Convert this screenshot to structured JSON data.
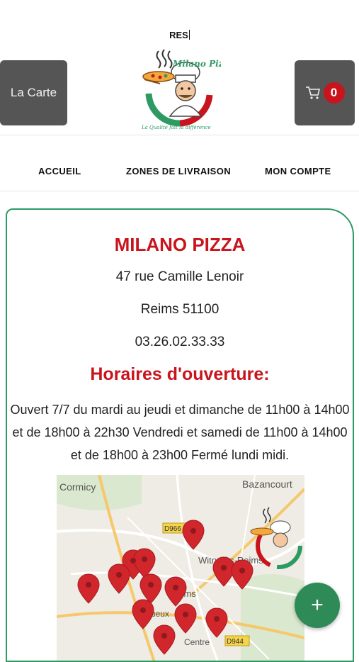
{
  "header": {
    "search_text": "RES",
    "menu_button_label": "La Carte",
    "cart_count": "0",
    "logo_title": "Milano Pizza",
    "logo_slogan": "La Qualité fait la différence"
  },
  "nav": {
    "items": [
      {
        "label": "ACCUEIL"
      },
      {
        "label": "ZONES DE LIVRAISON"
      },
      {
        "label": "MON COMPTE"
      }
    ]
  },
  "restaurant": {
    "name": "MILANO PIZZA",
    "address": "47 rue Camille Lenoir",
    "city": "Reims 51100",
    "phone": "03.26.02.33.33",
    "hours_title": "Horaires d'ouverture:",
    "hours_text": "Ouvert 7/7 du mardi au jeudi et dimanche de 11h00 à 14h00 et de 18h00 à 22h30  Vendredi et samedi de 11h00 à 14h00 et de 18h00 à 23h00  Fermé lundi midi."
  },
  "map": {
    "labels": {
      "cormicy": "Cormicy",
      "bazancourt": "Bazancourt",
      "d966": "D966",
      "witry": "Witry-lès-Reims",
      "reims": "Reims",
      "tinqueux": "Tinqueux",
      "d944": "D944",
      "centre": "Centre"
    }
  },
  "fab": {
    "label": "+"
  },
  "colors": {
    "brand_red": "#c9141d",
    "brand_green": "#2e9a63",
    "button_gray": "#555555"
  }
}
